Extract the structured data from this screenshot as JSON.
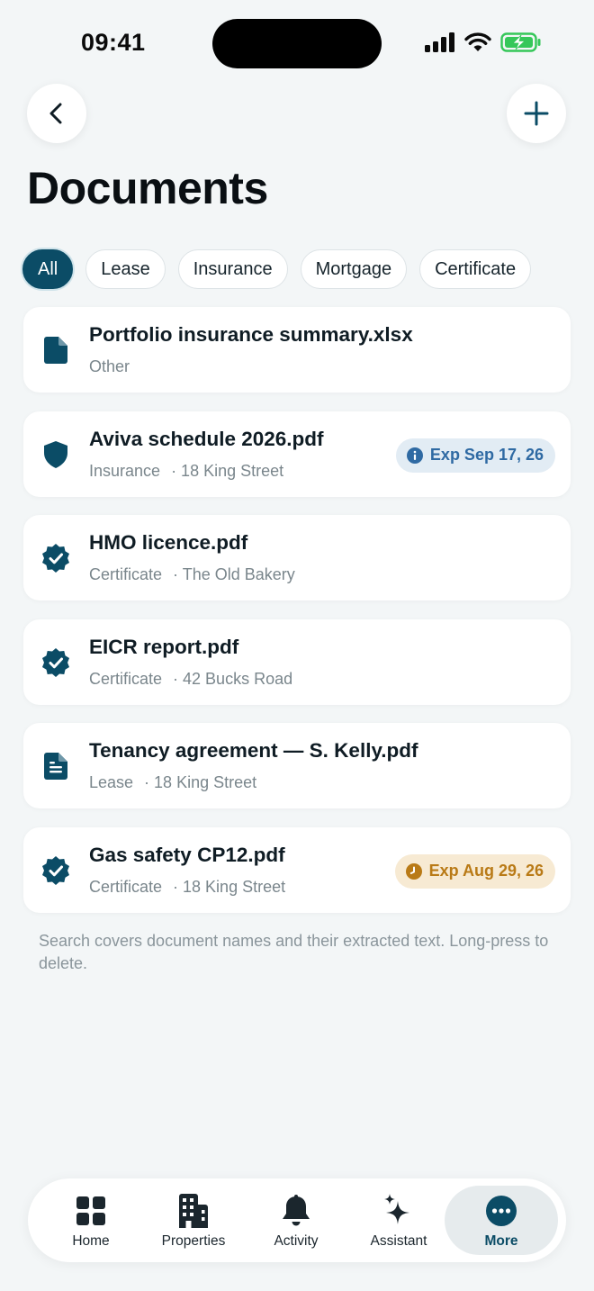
{
  "status_bar": {
    "time": "09:41"
  },
  "header": {
    "title": "Documents",
    "back_icon": "chevron-left-icon",
    "add_icon": "plus-icon"
  },
  "filters": [
    {
      "label": "All",
      "active": true
    },
    {
      "label": "Lease",
      "active": false
    },
    {
      "label": "Insurance",
      "active": false
    },
    {
      "label": "Mortgage",
      "active": false
    },
    {
      "label": "Certificate",
      "active": false
    }
  ],
  "documents": [
    {
      "name": "Portfolio insurance summary.xlsx",
      "category": "Other",
      "property": "",
      "icon": "document-icon",
      "badge": null
    },
    {
      "name": "Aviva schedule 2026.pdf",
      "category": "Insurance",
      "property": "· 18 King Street",
      "icon": "shield-icon",
      "badge": {
        "type": "info",
        "text": "Exp Sep 17, 26",
        "icon": "info-icon"
      }
    },
    {
      "name": "HMO licence.pdf",
      "category": "Certificate",
      "property": "· The Old Bakery",
      "icon": "verified-badge-icon",
      "badge": null
    },
    {
      "name": "EICR report.pdf",
      "category": "Certificate",
      "property": "· 42 Bucks Road",
      "icon": "verified-badge-icon",
      "badge": null
    },
    {
      "name": "Tenancy agreement — S. Kelly.pdf",
      "category": "Lease",
      "property": "· 18 King Street",
      "icon": "document-text-icon",
      "badge": null
    },
    {
      "name": "Gas safety CP12.pdf",
      "category": "Certificate",
      "property": "· 18 King Street",
      "icon": "verified-badge-icon",
      "badge": {
        "type": "warn",
        "text": "Exp Aug 29, 26",
        "icon": "clock-icon"
      }
    }
  ],
  "footnote": "Search covers document names and their extracted text. Long-press to delete.",
  "tabbar": {
    "home": "Home",
    "properties": "Properties",
    "activity": "Activity",
    "assistant": "Assistant",
    "more": "More"
  },
  "colors": {
    "accent": "#0b4c66",
    "background": "#f3f6f7",
    "info_badge_bg": "#e2ecf4",
    "info_badge_text": "#2f6aa3",
    "warn_badge_bg": "#f7ead3",
    "warn_badge_text": "#b97a16",
    "battery": "#35c759"
  }
}
